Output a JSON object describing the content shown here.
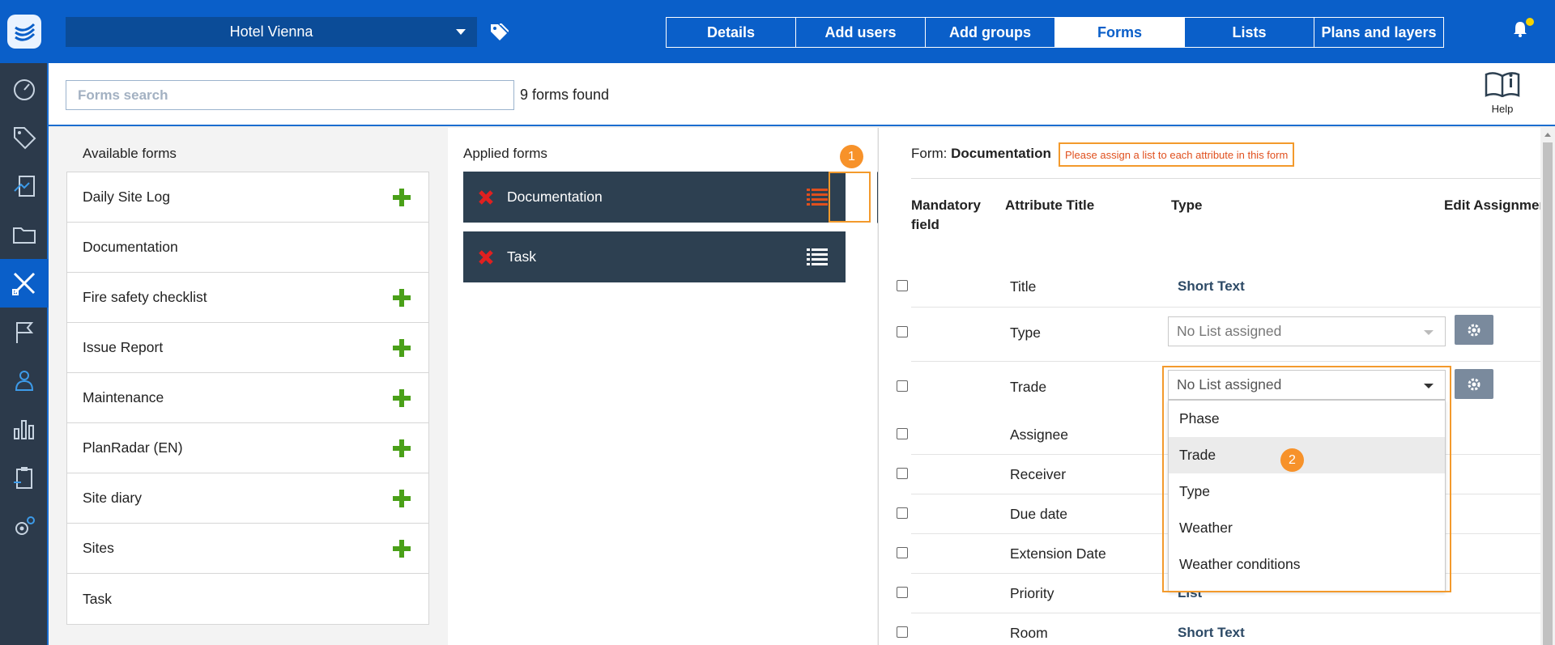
{
  "header": {
    "project": "Hotel Vienna",
    "tabs": [
      {
        "label": "Details"
      },
      {
        "label": "Add users"
      },
      {
        "label": "Add groups"
      },
      {
        "label": "Forms"
      },
      {
        "label": "Lists"
      },
      {
        "label": "Plans and layers"
      }
    ],
    "active_tab": "Forms"
  },
  "search": {
    "placeholder": "Forms search",
    "count_text": "9 forms found",
    "help_label": "Help"
  },
  "available": {
    "title": "Available forms",
    "items": [
      {
        "label": "Daily Site Log",
        "addable": true
      },
      {
        "label": "Documentation",
        "addable": false
      },
      {
        "label": "Fire safety checklist",
        "addable": true
      },
      {
        "label": "Issue Report",
        "addable": true
      },
      {
        "label": "Maintenance",
        "addable": true
      },
      {
        "label": "PlanRadar (EN)",
        "addable": true
      },
      {
        "label": "Site diary",
        "addable": true
      },
      {
        "label": "Sites",
        "addable": true
      },
      {
        "label": "Task",
        "addable": false
      }
    ]
  },
  "applied": {
    "title": "Applied forms",
    "items": [
      {
        "label": "Documentation"
      },
      {
        "label": "Task"
      }
    ]
  },
  "editor": {
    "form_prefix": "Form:",
    "form_name": "Documentation",
    "warning": "Please assign a list to each attribute in this form",
    "columns": {
      "mandatory": "Mandatory field",
      "title": "Attribute Title",
      "type": "Type",
      "edit": "Edit Assignmen"
    },
    "rows": [
      {
        "title": "Title",
        "type": "Short Text"
      },
      {
        "title": "Type",
        "select": "No List assigned"
      },
      {
        "title": "Trade",
        "select": "No List assigned"
      },
      {
        "title": "Assignee"
      },
      {
        "title": "Receiver"
      },
      {
        "title": "Due date"
      },
      {
        "title": "Extension Date"
      },
      {
        "title": "Priority",
        "type": "List"
      },
      {
        "title": "Room",
        "type": "Short Text"
      }
    ],
    "dropdown_options": [
      "Phase",
      "Trade",
      "Type",
      "Weather",
      "Weather conditions"
    ]
  },
  "badges": [
    "1",
    "2"
  ],
  "colors": {
    "brand": "#0a5fc9",
    "nav": "#2c3a4b",
    "card": "#2d4051",
    "add": "#4aa018",
    "remove": "#e02020",
    "highlight": "#f39a2c"
  }
}
